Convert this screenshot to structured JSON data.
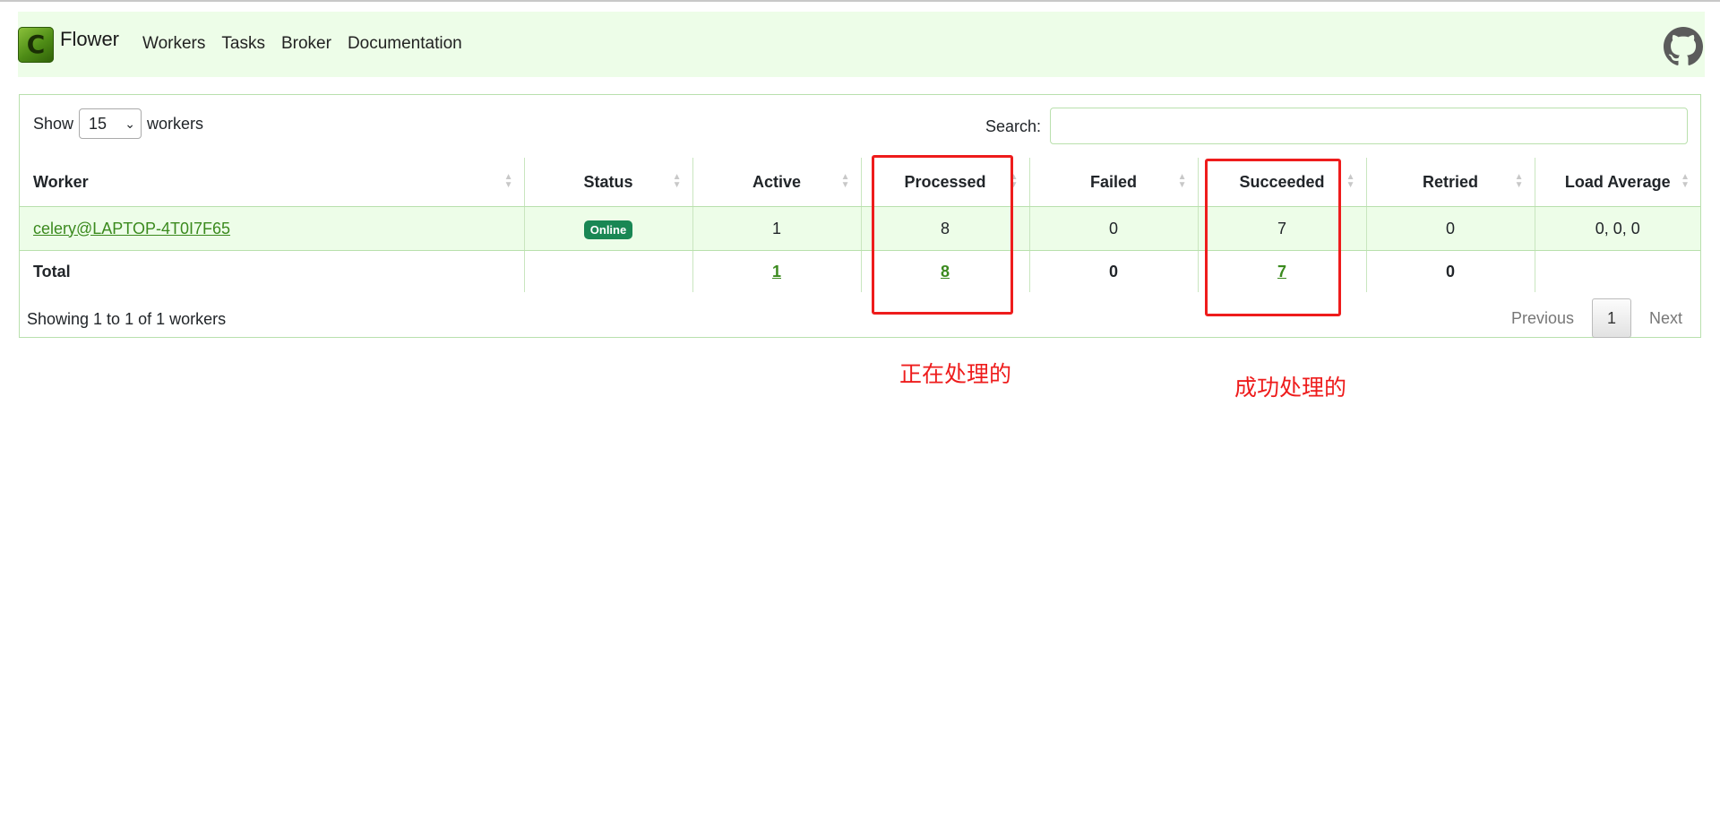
{
  "nav": {
    "logo_letter": "C",
    "brand": "Flower",
    "links": [
      "Workers",
      "Tasks",
      "Broker",
      "Documentation"
    ],
    "github_icon": "github-icon"
  },
  "controls": {
    "show_label": "Show",
    "page_size": "15",
    "workers_label": "workers",
    "search_label": "Search:",
    "search_value": ""
  },
  "table": {
    "headers": [
      "Worker",
      "Status",
      "Active",
      "Processed",
      "Failed",
      "Succeeded",
      "Retried",
      "Load Average"
    ],
    "row": {
      "worker": "celery@LAPTOP-4T0I7F65",
      "status": "Online",
      "active": "1",
      "processed": "8",
      "failed": "0",
      "succeeded": "7",
      "retried": "0",
      "load_average": "0, 0, 0"
    },
    "total": {
      "label": "Total",
      "active": "1",
      "processed": "8",
      "failed": "0",
      "succeeded": "7",
      "retried": "0"
    }
  },
  "footer": {
    "info": "Showing 1 to 1 of 1 workers",
    "previous": "Previous",
    "current_page": "1",
    "next": "Next"
  },
  "annotations": {
    "processed_note": "正在处理的",
    "succeeded_note": "成功处理的",
    "highlight_color": "#ee1c1c"
  },
  "colors": {
    "brand_bg": "#edfde8",
    "link": "#3b8a1e",
    "status_online": "#198754"
  }
}
